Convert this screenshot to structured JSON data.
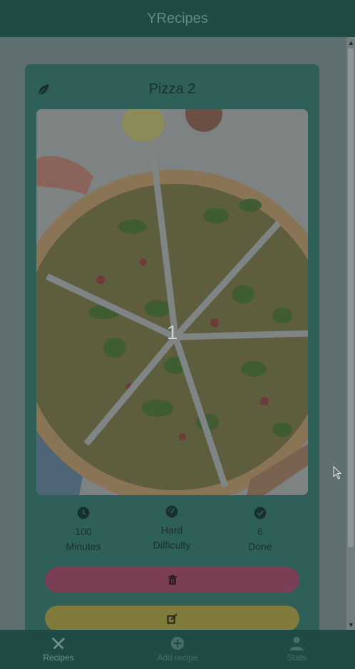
{
  "app": {
    "title": "YRecipes"
  },
  "recipe": {
    "title": "Pizza 2",
    "image_index": "1",
    "stats": [
      {
        "icon": "clock-icon",
        "value": "100",
        "label": "Minutes"
      },
      {
        "icon": "speedometer-icon",
        "value": "Hard",
        "label": "Difficulty"
      },
      {
        "icon": "check-circle-icon",
        "value": "6",
        "label": "Done"
      }
    ]
  },
  "actions": [
    {
      "name": "delete",
      "icon": "trash-icon",
      "color": "#7a3f54"
    },
    {
      "name": "edit",
      "icon": "edit-icon",
      "color": "#807a3c"
    }
  ],
  "nav": [
    {
      "label": "Recipes",
      "icon": "utensils-icon",
      "active": true
    },
    {
      "label": "Add recipe",
      "icon": "plus-circle-icon",
      "active": false
    },
    {
      "label": "Stats",
      "icon": "person-icon",
      "active": false
    }
  ],
  "colors": {
    "primary": "#1f4a45",
    "card": "#2e5f58",
    "delete": "#7a3f54",
    "edit": "#807a3c"
  }
}
